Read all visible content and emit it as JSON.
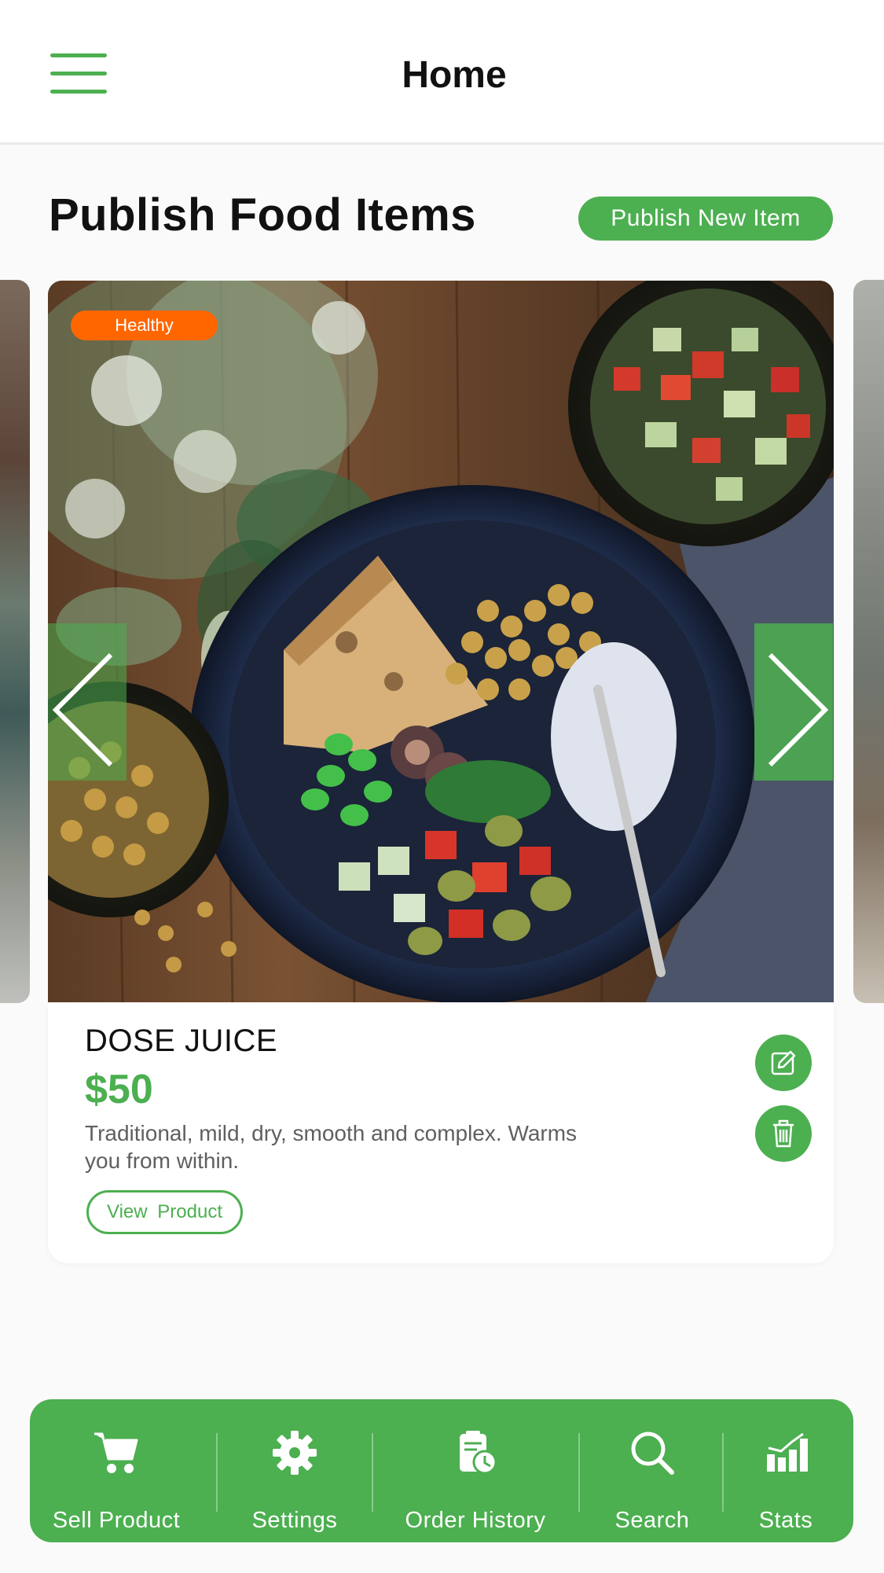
{
  "header": {
    "title": "Home",
    "menu_icon": "hamburger-menu-icon"
  },
  "section": {
    "title": "Publish Food Items",
    "publish_button": "Publish New Item"
  },
  "card": {
    "badge": "Healthy",
    "name": "DOSE JUICE",
    "price": "$50",
    "description": "Traditional, mild, dry, smooth and complex. Warms you from within.",
    "view_button": "View  Product",
    "image_subject": "bowl-of-salad-photo"
  },
  "bottom_nav": {
    "items": [
      {
        "label": "Sell Product",
        "icon": "cart-icon"
      },
      {
        "label": "Settings",
        "icon": "gear-icon"
      },
      {
        "label": "Order History",
        "icon": "clipboard-clock-icon"
      },
      {
        "label": "Search",
        "icon": "search-icon"
      },
      {
        "label": "Stats",
        "icon": "bar-chart-icon"
      }
    ]
  },
  "colors": {
    "accent": "#4caf50",
    "badge": "#ff6600",
    "text_primary": "#111111",
    "text_secondary": "#5f5f5f"
  }
}
